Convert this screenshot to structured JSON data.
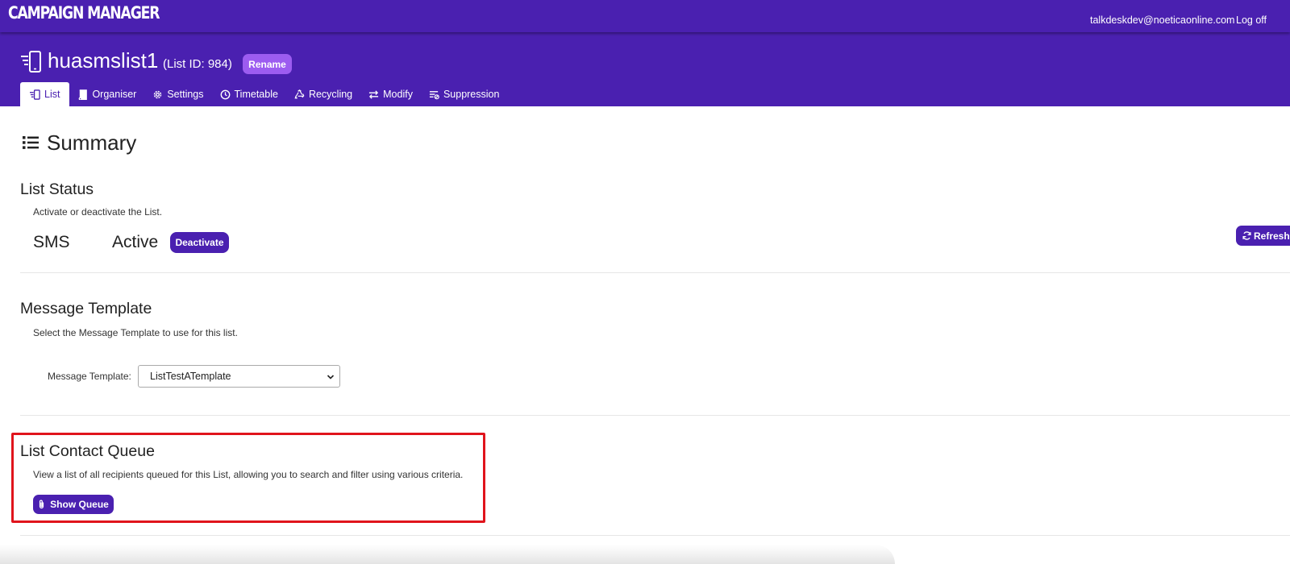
{
  "app": {
    "brand": "CAMPAIGN MANAGER",
    "user_email": "talkdeskdev@noeticaonline.com",
    "logoff_label": "Log off"
  },
  "header": {
    "list_name": "huasmslist1",
    "list_id_text": "(List ID: 984)",
    "rename_label": "Rename",
    "tabs": [
      {
        "label": "List",
        "icon": "list-icon",
        "active": true
      },
      {
        "label": "Organiser",
        "icon": "book-icon",
        "active": false
      },
      {
        "label": "Settings",
        "icon": "gear-icon",
        "active": false
      },
      {
        "label": "Timetable",
        "icon": "clock-icon",
        "active": false
      },
      {
        "label": "Recycling",
        "icon": "recycle-icon",
        "active": false
      },
      {
        "label": "Modify",
        "icon": "exchange-icon",
        "active": false
      },
      {
        "label": "Suppression",
        "icon": "filter-list-icon",
        "active": false
      }
    ]
  },
  "summary": {
    "title": "Summary",
    "icon": "list-bullets-icon"
  },
  "list_status": {
    "title": "List Status",
    "description": "Activate or deactivate the List.",
    "channel": "SMS",
    "status": "Active",
    "deactivate_label": "Deactivate",
    "refresh_label": "Refresh"
  },
  "message_template": {
    "title": "Message Template",
    "description": "Select the Message Template to use for this list.",
    "field_label": "Message Template:",
    "selected_value": "ListTestATemplate"
  },
  "contact_queue": {
    "title": "List Contact Queue",
    "description": "View a list of all recipients queued for this List, allowing you to search and filter using various criteria.",
    "show_queue_label": "Show Queue"
  },
  "colors": {
    "brand_purple": "#4a20b0",
    "rename_purple": "#9c5cf0",
    "highlight_red": "#e0141c"
  }
}
